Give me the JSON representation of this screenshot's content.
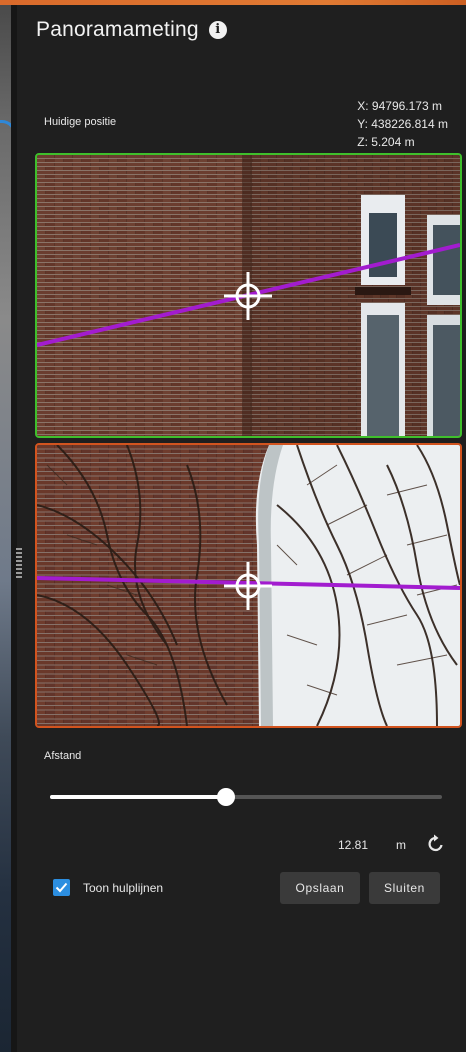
{
  "panel": {
    "title": "Panoramameting",
    "info_icon": "info-icon"
  },
  "position": {
    "label": "Huidige positie",
    "x": "X: 94796.173 m",
    "y": "Y: 438226.814 m",
    "z": "Z: 5.204 m"
  },
  "views": {
    "top_border_color": "#3fbf2c",
    "bottom_border_color": "#d2541f",
    "measure_line_color": "#a21ccf",
    "crosshair_icon": "crosshair-icon"
  },
  "distance": {
    "label": "Afstand",
    "value": "12.81",
    "unit": "m",
    "slider_fraction": 0.45,
    "reset_icon": "reset-icon"
  },
  "options": {
    "show_guides_label": "Toon hulplijnen",
    "show_guides_checked": true
  },
  "buttons": {
    "save": "Opslaan",
    "close": "Sluiten"
  },
  "colors": {
    "accent": "#2c8ee0",
    "panel_bg": "#1f1f1f",
    "button_bg": "#3a3a3a"
  }
}
